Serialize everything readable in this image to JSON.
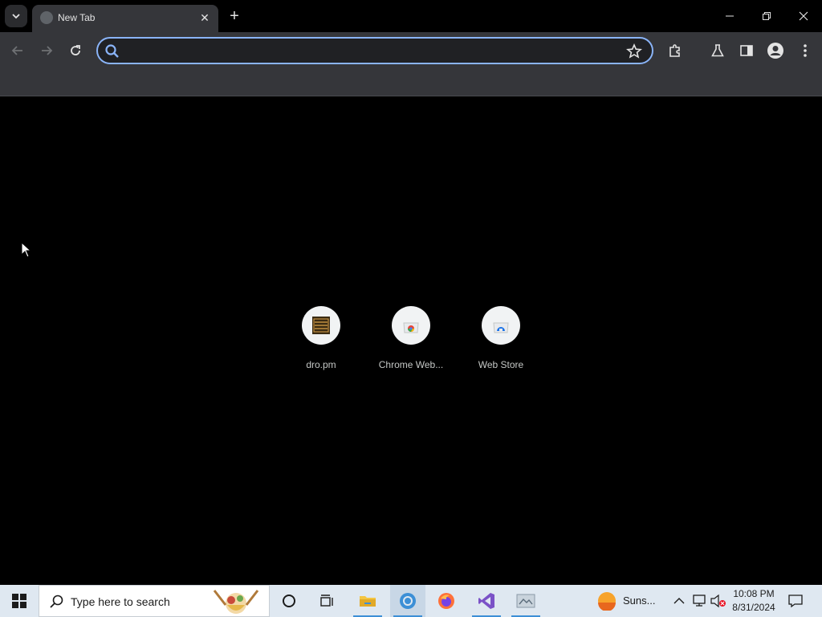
{
  "browser": {
    "tab": {
      "title": "New Tab",
      "close_glyph": "✕"
    },
    "new_tab_glyph": "+",
    "omnibox": {
      "value": "",
      "placeholder": ""
    }
  },
  "shortcuts": [
    {
      "label": "dro.pm",
      "icon": "dro-pm-icon"
    },
    {
      "label": "Chrome Web...",
      "icon": "chrome-web-store-icon"
    },
    {
      "label": "Web Store",
      "icon": "web-store-icon"
    }
  ],
  "taskbar": {
    "search_placeholder": "Type here to search",
    "weather_text": "Suns...",
    "clock_time": "10:08 PM",
    "clock_date": "8/31/2024"
  },
  "colors": {
    "accent": "#8ab4f8",
    "toolbar_bg": "#35363a",
    "taskbar_bg": "#dfe8f1"
  }
}
